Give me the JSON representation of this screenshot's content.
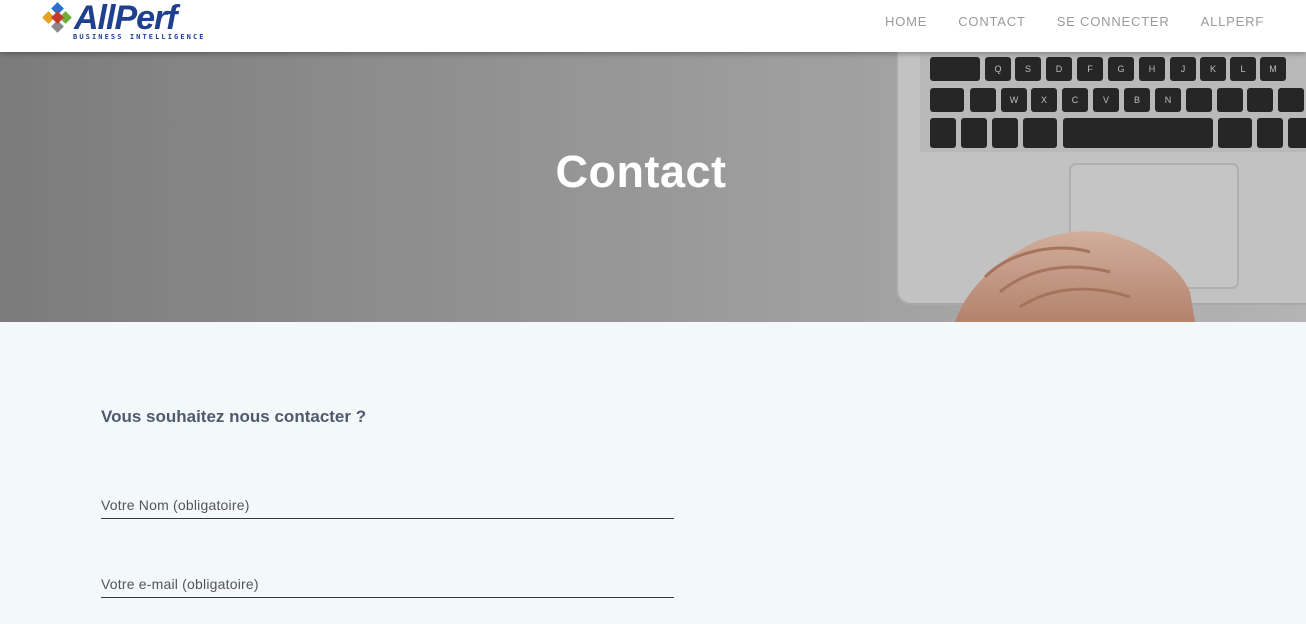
{
  "header": {
    "logo": {
      "name": "AllPerf",
      "tagline": "BUSINESS INTELLIGENCE"
    },
    "nav": [
      {
        "label": "HOME"
      },
      {
        "label": "CONTACT"
      },
      {
        "label": "SE CONNECTER"
      },
      {
        "label": "ALLPERF"
      }
    ]
  },
  "hero": {
    "title": "Contact",
    "keyboard_keys_row1": [
      "Q",
      "S",
      "D",
      "F",
      "G",
      "H",
      "J",
      "K",
      "L",
      "M"
    ],
    "keyboard_keys_row2": [
      "W",
      "X",
      "C",
      "V",
      "B",
      "N"
    ]
  },
  "contact": {
    "heading": "Vous souhaitez nous contacter ?",
    "fields": [
      {
        "label": "Votre Nom (obligatoire)",
        "value": ""
      },
      {
        "label": "Votre e-mail (obligatoire)",
        "value": ""
      }
    ]
  },
  "colors": {
    "brand": "#1f3f8f",
    "nav_text": "#9a9a9a",
    "heading": "#505a6c",
    "page_bg": "#f3f8fb"
  }
}
